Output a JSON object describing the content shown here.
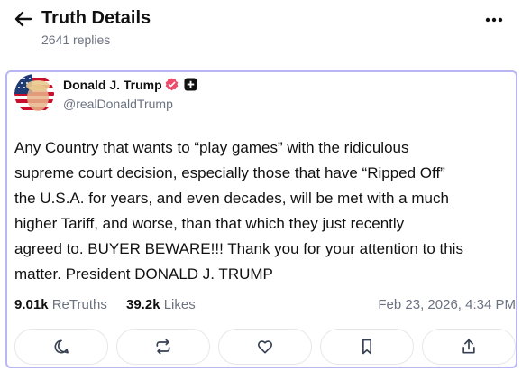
{
  "header": {
    "title": "Truth Details",
    "replies": "2641 replies"
  },
  "post": {
    "author_name": "Donald J. Trump",
    "handle": "@realDonaldTrump",
    "body_lines": [
      "Any Country that wants to “play games” with the ridiculous",
      "supreme court decision, especially those that have “Ripped Off”",
      "the U.S.A. for years, and even decades, will be met with a much",
      "higher Tariff, and worse, than that which they just recently",
      "agreed to. BUYER BEWARE!!! Thank you for your attention to this",
      "matter. President DONALD J. TRUMP"
    ],
    "retruths_count": "9.01k",
    "retruths_label": "ReTruths",
    "likes_count": "39.2k",
    "likes_label": "Likes",
    "timestamp": "Feb 23, 2026, 4:34 PM"
  },
  "icons": {
    "back": "arrow-left-icon",
    "more": "more-horizontal-icon",
    "verified": "verified-badge-icon",
    "plus": "plus-badge-icon",
    "reply": "reply-bubble-icon",
    "retruth": "repost-icon",
    "like": "heart-icon",
    "bookmark": "bookmark-icon",
    "share": "share-icon"
  },
  "colors": {
    "card_border": "#b9b6f3",
    "verified": "#ef4a6a",
    "muted_text": "#6b7280"
  }
}
